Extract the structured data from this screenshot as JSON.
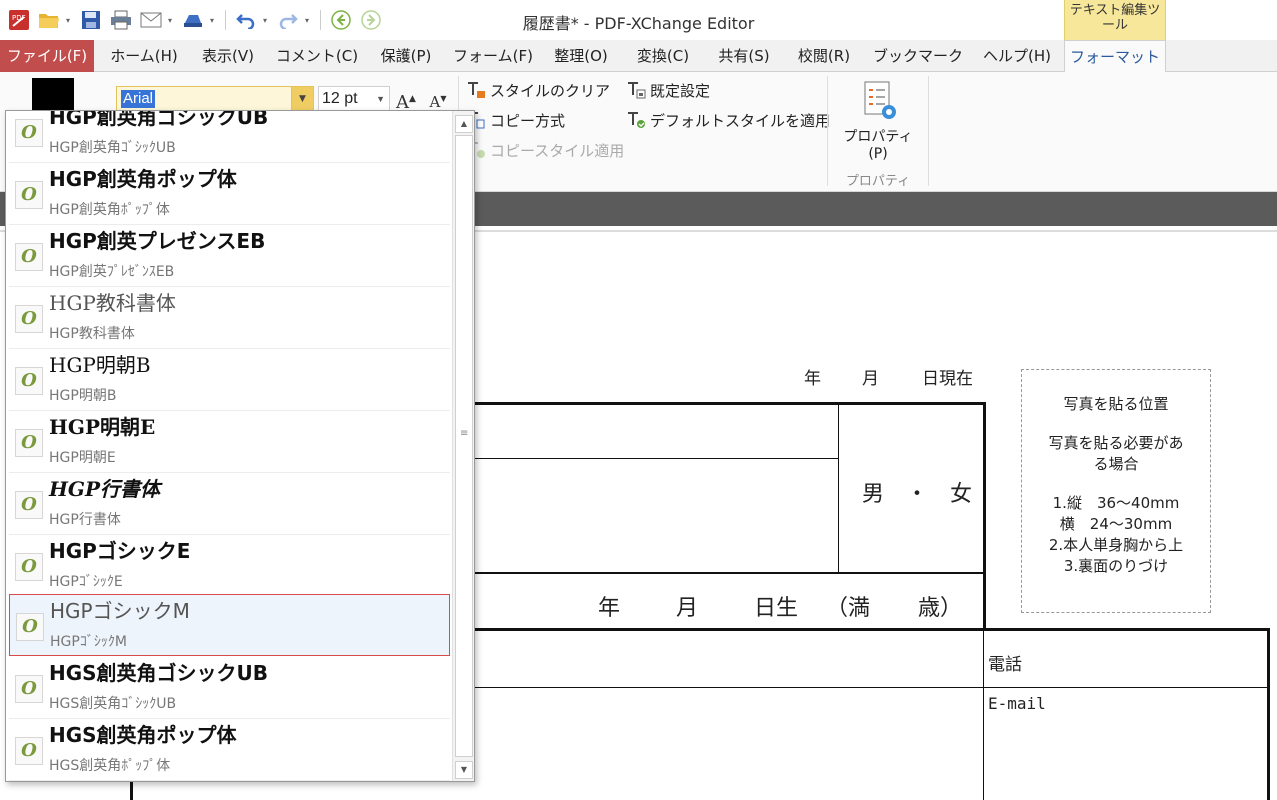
{
  "window": {
    "title": "履歴書* - PDF-XChange Editor",
    "context_tab_group": "テキスト編集ツール"
  },
  "ribbon_tabs": [
    {
      "label": "ファイル(F)",
      "state": "file"
    },
    {
      "label": "ホーム(H)"
    },
    {
      "label": "表示(V)"
    },
    {
      "label": "コメント(C)"
    },
    {
      "label": "保護(P)"
    },
    {
      "label": "フォーム(F)"
    },
    {
      "label": "整理(O)"
    },
    {
      "label": "変換(C)"
    },
    {
      "label": "共有(S)"
    },
    {
      "label": "校閲(R)"
    },
    {
      "label": "ブックマーク"
    },
    {
      "label": "ヘルプ(H)"
    },
    {
      "label": "フォーマット",
      "state": "active"
    }
  ],
  "format_ribbon": {
    "font_value": "Arial",
    "size_value": "12 pt",
    "grow_glyph": "A",
    "shrink_glyph": "A",
    "clear_style": "スタイルのクリア",
    "copy_format": "コピー方式",
    "apply_copy_style": "コピースタイル適用",
    "default_setting": "既定設定",
    "apply_default_style": "デフォルトスタイルを適用",
    "properties_button": "プロパティ(P)",
    "properties_group": "プロパティ"
  },
  "colors": {
    "file_tab": "#c24d4d",
    "context_group": "#f7e79a",
    "selection_border": "#d94a4a",
    "doc_strip": "#5b5b5b"
  },
  "font_dropdown": {
    "icon_glyph": "O",
    "items": [
      {
        "name": "HGP創英角ゴシックUB",
        "sub": "HGP創英角ｺﾞｼｯｸUB",
        "style": "bold"
      },
      {
        "name": "HGP創英角ポップ体",
        "sub": "HGP創英角ﾎﾟｯﾌﾟ体",
        "style": "bold"
      },
      {
        "name": "HGP創英プレゼンスEB",
        "sub": "HGP創英ﾌﾟﾚｾﾞﾝｽEB",
        "style": "bold"
      },
      {
        "name": "HGP教科書体",
        "sub": "HGP教科書体",
        "style": "light"
      },
      {
        "name": "HGP明朝B",
        "sub": "HGP明朝B",
        "style": "serif"
      },
      {
        "name": "HGP明朝E",
        "sub": "HGP明朝E",
        "style": "serif-bold"
      },
      {
        "name": "HGP行書体",
        "sub": "HGP行書体",
        "style": "script"
      },
      {
        "name": "HGPゴシックE",
        "sub": "HGPｺﾞｼｯｸE",
        "style": "bold"
      },
      {
        "name": "HGPゴシックM",
        "sub": "HGPｺﾞｼｯｸM",
        "style": "light",
        "selected": true
      },
      {
        "name": "HGS創英角ゴシックUB",
        "sub": "HGS創英角ｺﾞｼｯｸUB",
        "style": "bold"
      },
      {
        "name": "HGS創英角ポップ体",
        "sub": "HGS創英角ﾎﾟｯﾌﾟ体",
        "style": "bold"
      }
    ]
  },
  "resume": {
    "date_year": "年",
    "date_month": "月",
    "date_current": "日現在",
    "gender": "男　・　女",
    "birth_year": "年",
    "birth_month": "月",
    "birth_day": "日生",
    "age_open": "（満",
    "age_close": "歳）",
    "phone_label": "電話",
    "email_label": "E-mail",
    "photo_box": {
      "title": "写真を貼る位置",
      "note_1": "写真を貼る必要があ",
      "note_2": "る場合",
      "line_1": "1.縦　36～40mm",
      "line_2": "横　24～30mm",
      "line_3": "2.本人単身胸から上",
      "line_4": "3.裏面のりづけ"
    }
  }
}
